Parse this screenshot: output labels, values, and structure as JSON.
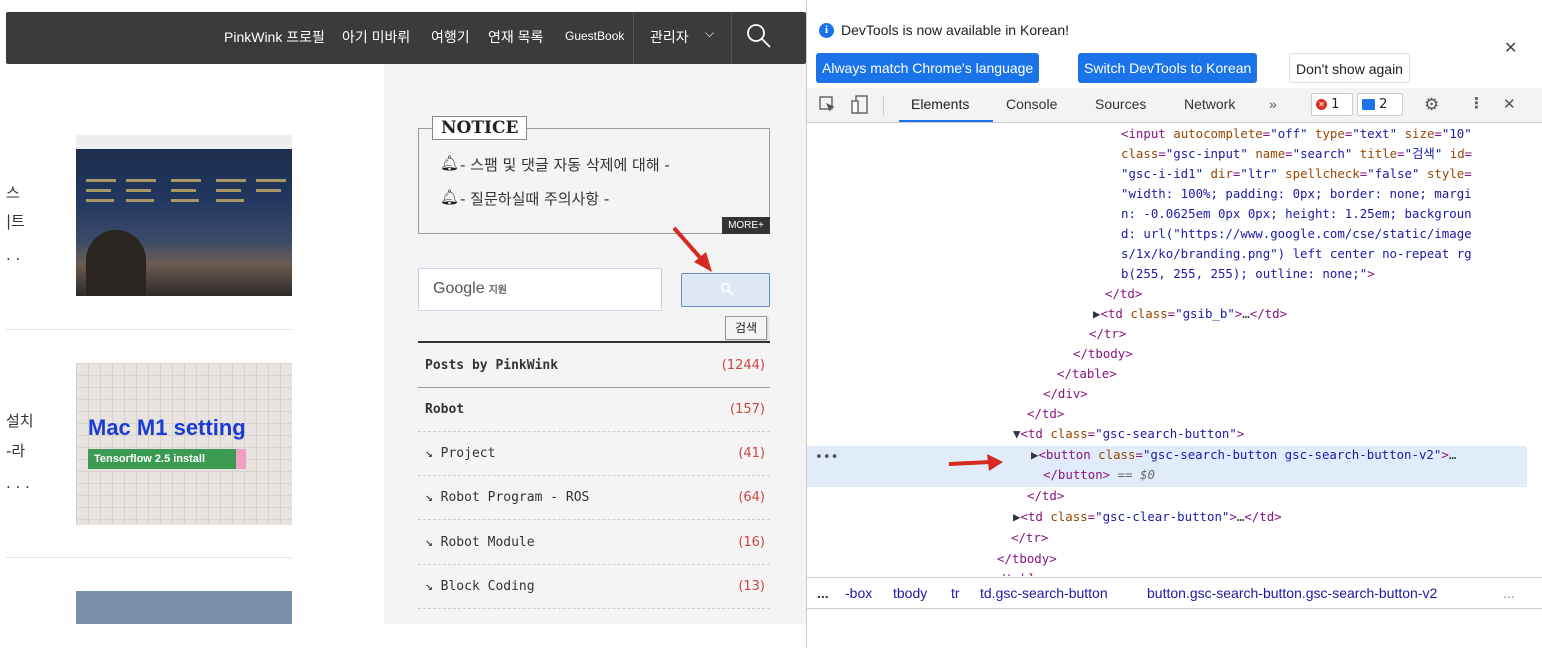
{
  "site": {
    "nav": [
      "PinkWink 프로필",
      "아기 미바뤼",
      "여행기",
      "연재 목록",
      "GuestBook",
      "관리자"
    ],
    "feed_cut_text": [
      "스",
      "|트",
      ". .",
      "설치",
      "-라",
      ". . ."
    ],
    "thumb2": {
      "title": "Mac M1 setting",
      "strip": "Tensorflow 2.5 install"
    },
    "notice": {
      "title": "NOTICE",
      "items": [
        "- 스팸 및 댓글 자동 삭제에 대해 -",
        "- 질문하실때 주의사항 -"
      ],
      "more": "MORE+"
    },
    "search": {
      "logo": "Google",
      "logo_sub": "지원",
      "tooltip": "검색"
    },
    "categories": [
      {
        "label": "Posts by PinkWink",
        "count": "(1244)"
      },
      {
        "label": "Robot",
        "count": "(157)"
      },
      {
        "label": "↘  Project",
        "count": "(41)"
      },
      {
        "label": "↘  Robot Program - ROS",
        "count": "(64)"
      },
      {
        "label": "↘  Robot Module",
        "count": "(16)"
      },
      {
        "label": "↘  Block Coding",
        "count": "(13)"
      }
    ]
  },
  "devtools": {
    "info_text": "DevTools is now available in Korean!",
    "info_buttons": [
      "Always match Chrome's language",
      "Switch DevTools to Korean",
      "Don't show again"
    ],
    "tabs": [
      "Elements",
      "Console",
      "Sources",
      "Network"
    ],
    "more_tabs": "»",
    "errors": "1",
    "messages": "2",
    "breadcrumb": [
      "...",
      "-box",
      "tbody",
      "tr",
      "td.gsc-search-button",
      "button.gsc-search-button.gsc-search-button-v2",
      "..."
    ]
  },
  "colors": {
    "accent": "#1a73e8",
    "nav_bg": "#3b3b3b",
    "selected_row": "#e1ecfb"
  }
}
